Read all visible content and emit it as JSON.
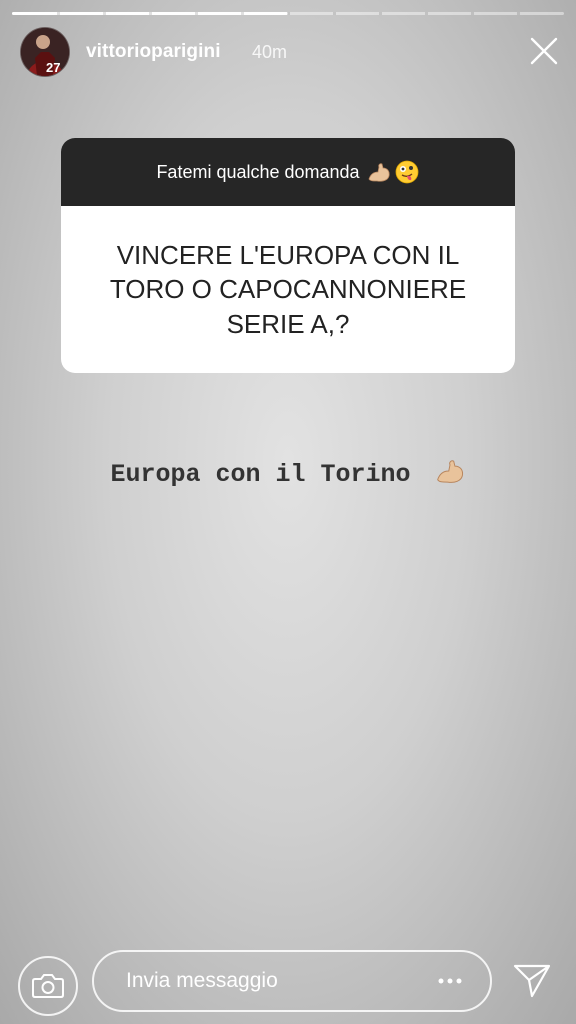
{
  "story": {
    "progress": 0.5,
    "segments": 12
  },
  "header": {
    "username": "vittorioparigini",
    "time": "40m",
    "avatar_jersey_number": "27"
  },
  "question_card": {
    "header_text": "Fatemi qualche domanda",
    "header_emojis": [
      "flexed-biceps",
      "zany-face"
    ],
    "question": "VINCERE L'EUROPA CON IL TORO O CAPOCANNONIERE SERIE A,?"
  },
  "answer": {
    "text": "Europa con il Torino",
    "emoji": "flexed-biceps"
  },
  "reply_bar": {
    "placeholder": "Invia messaggio",
    "camera_icon": "camera-icon",
    "more_icon": "more-icon",
    "send_icon": "send-icon"
  },
  "colors": {
    "card_header_bg": "#262626",
    "card_body_bg": "#ffffff",
    "question_text": "#222222",
    "answer_text": "#333333",
    "overlay_white": "#ffffff"
  }
}
